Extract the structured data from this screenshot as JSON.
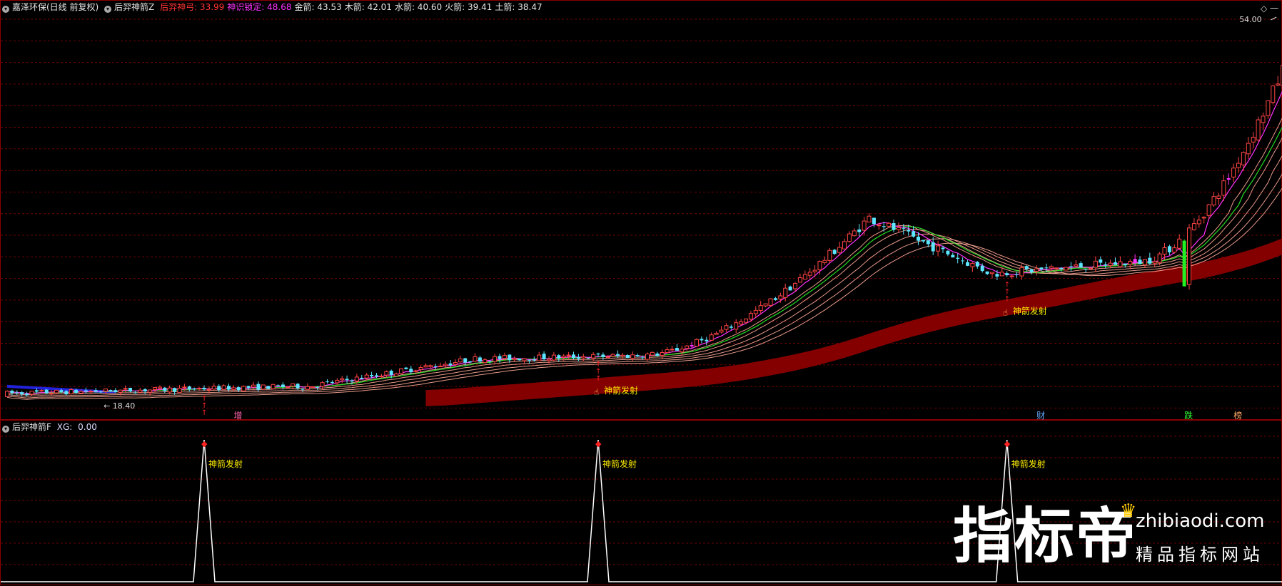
{
  "header": {
    "stock": "嘉泽环保(日线 前复权)",
    "indicator_main": "后羿神箭Z",
    "values": [
      {
        "label": "后羿神弓: ",
        "value": "33.99",
        "color": "#ff3333"
      },
      {
        "label": "神识锁定: ",
        "value": "48.68",
        "color": "#ff33ff"
      },
      {
        "label": "金箭: ",
        "value": "43.53",
        "color": "#e6e6e6"
      },
      {
        "label": "木箭: ",
        "value": "42.01",
        "color": "#e6e6e6"
      },
      {
        "label": "水箭: ",
        "value": "40.60",
        "color": "#e6e6e6"
      },
      {
        "label": "火箭: ",
        "value": "39.41",
        "color": "#e6e6e6"
      },
      {
        "label": "土箭: ",
        "value": "38.47",
        "color": "#e6e6e6"
      }
    ]
  },
  "sub_header": {
    "indicator": "后羿神箭F",
    "label": "XG: ",
    "value": "0.00"
  },
  "right_icons": "◇ 一",
  "watermark": {
    "brand": "指标帝",
    "domain": "zhibiaodi.com",
    "slogan": "精品指标网站"
  },
  "chart_data": {
    "type": "candlestick",
    "price_range": [
      17.5,
      56.5
    ],
    "high_label": "54.00",
    "low_label": "← 18.40",
    "signal_text": "神箭发射",
    "signal_bars": [
      40,
      120,
      203
    ],
    "bottom_markers": [
      {
        "bar": 46,
        "text": "增",
        "color": "#ff66aa"
      },
      {
        "bar": 209,
        "text": "财",
        "color": "#66aaff"
      },
      {
        "bar": 239,
        "text": "跌",
        "color": "#33ff33"
      },
      {
        "bar": 249,
        "text": "榜",
        "color": "#ffaa66"
      }
    ],
    "colors": {
      "up": "#ff4444",
      "down": "#5ce6ff",
      "ma_short": "#ff33ff",
      "ma_green": "#22dd22",
      "fan": "#ffaa99",
      "band": "#8b0000",
      "blue_line": "#2222dd",
      "signal": "#ffee00",
      "arrow": "#ff2222"
    },
    "candles_note": "O,C,H,L per bar in price units (generated deterministically in script)",
    "sub_chart": {
      "type": "line",
      "ylim": [
        0,
        1
      ],
      "peaks_at_bars": [
        40,
        120,
        203
      ]
    }
  }
}
